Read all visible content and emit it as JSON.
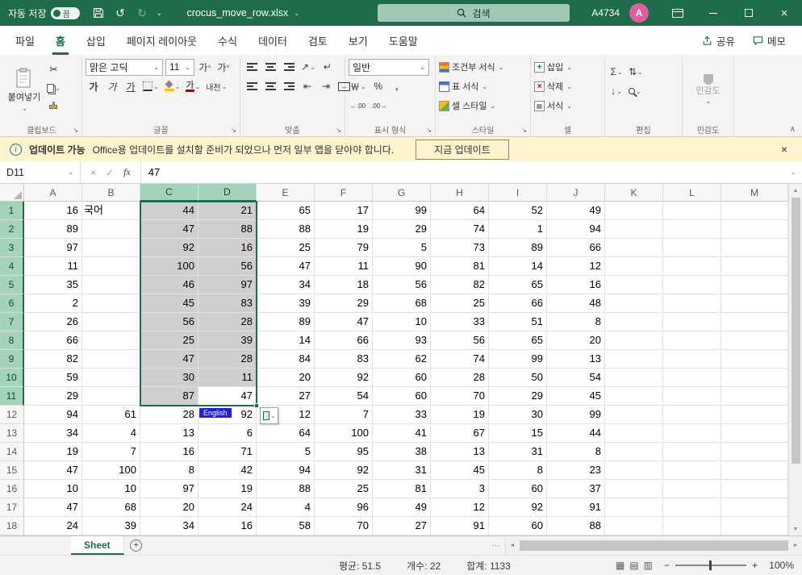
{
  "titlebar": {
    "autosave_label": "자동 저장",
    "autosave_state": "끔",
    "filename": "crocus_move_row.xlsx",
    "search_placeholder": "검색",
    "user_id": "A4734",
    "avatar_letter": "A"
  },
  "icons": {
    "chevron_down": "⌄",
    "collapse_up": "∧",
    "undo": "↺",
    "redo": "↻",
    "close": "×",
    "cut": "✂",
    "grow_font": "가",
    "shrink_font": "가",
    "bold": "가",
    "italic": "가",
    "underline": "가",
    "phonetic": "내천",
    "orientation": "↗",
    "wrap": "↵",
    "indent_dec": "⇤",
    "indent_inc": "⇥",
    "merge_arrows": "↔",
    "currency": "￦",
    "percent": "%",
    "comma": ",",
    "decimal_increase": "←.00",
    "decimal_decrease": ".00→",
    "sigma": "Σ",
    "sort": "⇅",
    "fill_down": "↓",
    "insert_plus": "+",
    "delete_x": "×",
    "format_grid": "▦",
    "cancel": "×",
    "check": "✓",
    "fx": "fx",
    "info": "i",
    "up_arrow": "▲",
    "down_arrow": "▼",
    "left_arrow": "◄",
    "right_arrow": "►",
    "ellipsis": "⋯",
    "add_sheet": "+",
    "view_normal": "▦",
    "view_layout": "▤",
    "view_break": "▥",
    "zoom_out": "−",
    "zoom_in": "+"
  },
  "ribbon": {
    "tabs": [
      "파일",
      "홈",
      "삽입",
      "페이지 레이아웃",
      "수식",
      "데이터",
      "검토",
      "보기",
      "도움말"
    ],
    "active_tab": "홈",
    "share_label": "공유",
    "comments_label": "메모",
    "clipboard": {
      "group_name": "클립보드",
      "paste_label": "붙여넣기"
    },
    "font": {
      "group_name": "글꼴",
      "name": "맑은 고딕",
      "size": "11"
    },
    "align": {
      "group_name": "맞춤"
    },
    "number": {
      "group_name": "표시 형식",
      "format": "일반"
    },
    "styles": {
      "group_name": "스타일",
      "buttons": [
        "조건부 서식",
        "표 서식",
        "셀 스타일"
      ]
    },
    "cells": {
      "group_name": "셀",
      "buttons": [
        "삽입",
        "삭제",
        "서식"
      ]
    },
    "editing": {
      "group_name": "편집"
    },
    "sensitivity": {
      "group_name": "민감도",
      "button_label": "민감도"
    }
  },
  "notification": {
    "title": "업데이트 가능",
    "message": "Office용 업데이트를 설치할 준비가 되었으나 먼저 일부 앱을 닫아야 합니다.",
    "action_label": "지금 업데이트"
  },
  "formula_bar": {
    "name_box": "D11",
    "value": "47"
  },
  "grid": {
    "columns": [
      "A",
      "B",
      "C",
      "D",
      "E",
      "F",
      "G",
      "H",
      "I",
      "J",
      "K",
      "L",
      "M"
    ],
    "selection": {
      "range": "C1:D11",
      "cols": [
        "C",
        "D"
      ],
      "row_start": 1,
      "row_end": 11,
      "active_cell": "D11"
    },
    "ime_tag": "English",
    "rows": [
      {
        "n": 1,
        "cells": {
          "A": "16",
          "B": "국어",
          "C": "44",
          "D": "21",
          "E": "65",
          "F": "17",
          "G": "99",
          "H": "64",
          "I": "52",
          "J": "49"
        }
      },
      {
        "n": 2,
        "cells": {
          "A": "89",
          "C": "47",
          "D": "88",
          "E": "88",
          "F": "19",
          "G": "29",
          "H": "74",
          "I": "1",
          "J": "94"
        }
      },
      {
        "n": 3,
        "cells": {
          "A": "97",
          "C": "92",
          "D": "16",
          "E": "25",
          "F": "79",
          "G": "5",
          "H": "73",
          "I": "89",
          "J": "66"
        }
      },
      {
        "n": 4,
        "cells": {
          "A": "11",
          "C": "100",
          "D": "56",
          "E": "47",
          "F": "11",
          "G": "90",
          "H": "81",
          "I": "14",
          "J": "12"
        }
      },
      {
        "n": 5,
        "cells": {
          "A": "35",
          "C": "46",
          "D": "97",
          "E": "34",
          "F": "18",
          "G": "56",
          "H": "82",
          "I": "65",
          "J": "16"
        }
      },
      {
        "n": 6,
        "cells": {
          "A": "2",
          "C": "45",
          "D": "83",
          "E": "39",
          "F": "29",
          "G": "68",
          "H": "25",
          "I": "66",
          "J": "48"
        }
      },
      {
        "n": 7,
        "cells": {
          "A": "26",
          "C": "56",
          "D": "28",
          "E": "89",
          "F": "47",
          "G": "10",
          "H": "33",
          "I": "51",
          "J": "8"
        }
      },
      {
        "n": 8,
        "cells": {
          "A": "66",
          "C": "25",
          "D": "39",
          "E": "14",
          "F": "66",
          "G": "93",
          "H": "56",
          "I": "65",
          "J": "20"
        }
      },
      {
        "n": 9,
        "cells": {
          "A": "82",
          "C": "47",
          "D": "28",
          "E": "84",
          "F": "83",
          "G": "62",
          "H": "74",
          "I": "99",
          "J": "13"
        }
      },
      {
        "n": 10,
        "cells": {
          "A": "59",
          "C": "30",
          "D": "11",
          "E": "20",
          "F": "92",
          "G": "60",
          "H": "28",
          "I": "50",
          "J": "54"
        }
      },
      {
        "n": 11,
        "cells": {
          "A": "29",
          "C": "87",
          "D": "47",
          "E": "27",
          "F": "54",
          "G": "60",
          "H": "70",
          "I": "29",
          "J": "45"
        }
      },
      {
        "n": 12,
        "cells": {
          "A": "94",
          "B": "61",
          "C": "28",
          "D": "92",
          "E": "12",
          "F": "7",
          "G": "33",
          "H": "19",
          "I": "30",
          "J": "99"
        }
      },
      {
        "n": 13,
        "cells": {
          "A": "34",
          "B": "4",
          "C": "13",
          "D": "6",
          "E": "64",
          "F": "100",
          "G": "41",
          "H": "67",
          "I": "15",
          "J": "44"
        }
      },
      {
        "n": 14,
        "cells": {
          "A": "19",
          "B": "7",
          "C": "16",
          "D": "71",
          "E": "5",
          "F": "95",
          "G": "38",
          "H": "13",
          "I": "31",
          "J": "8"
        }
      },
      {
        "n": 15,
        "cells": {
          "A": "47",
          "B": "100",
          "C": "8",
          "D": "42",
          "E": "94",
          "F": "92",
          "G": "31",
          "H": "45",
          "I": "8",
          "J": "23"
        }
      },
      {
        "n": 16,
        "cells": {
          "A": "10",
          "B": "10",
          "C": "97",
          "D": "19",
          "E": "88",
          "F": "25",
          "G": "81",
          "H": "3",
          "I": "60",
          "J": "37"
        }
      },
      {
        "n": 17,
        "cells": {
          "A": "47",
          "B": "68",
          "C": "20",
          "D": "24",
          "E": "4",
          "F": "96",
          "G": "49",
          "H": "12",
          "I": "92",
          "J": "91"
        }
      },
      {
        "n": 18,
        "cells": {
          "A": "24",
          "B": "39",
          "C": "34",
          "D": "16",
          "E": "58",
          "F": "70",
          "G": "27",
          "H": "91",
          "I": "60",
          "J": "88"
        }
      }
    ]
  },
  "sheet_bar": {
    "active_tab": "Sheet"
  },
  "status_bar": {
    "average": "평균: 51.5",
    "count": "개수: 22",
    "sum": "합계: 1133",
    "zoom": "100%"
  }
}
